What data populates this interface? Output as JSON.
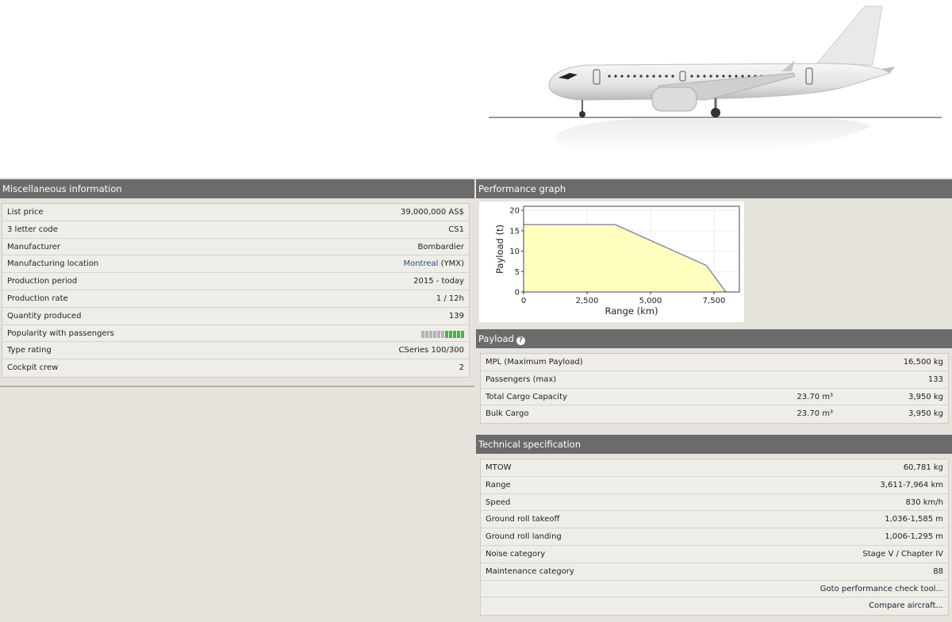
{
  "misc": {
    "title": "Miscellaneous information",
    "rows": [
      {
        "label": "List price",
        "value": "39,000,000 AS$"
      },
      {
        "label": "3 letter code",
        "value": "CS1"
      },
      {
        "label": "Manufacturer",
        "value": "Bombardier"
      },
      {
        "label": "Manufacturing location",
        "value_city": "Montreal",
        "value_code": " (YMX)"
      },
      {
        "label": "Production period",
        "value": "2015 - today"
      },
      {
        "label": "Production rate",
        "value": "1 / 12h"
      },
      {
        "label": "Quantity produced",
        "value": "139"
      },
      {
        "label": "Popularity with passengers",
        "popularity": {
          "filled": 5,
          "total": 11
        }
      },
      {
        "label": "Type rating",
        "value": "CSeries 100/300"
      },
      {
        "label": "Cockpit crew",
        "value": "2"
      }
    ]
  },
  "performance": {
    "title": "Performance graph"
  },
  "chart_data": {
    "type": "area",
    "x": [
      0,
      3611,
      7200,
      7964
    ],
    "y": [
      16.5,
      16.5,
      6.5,
      0
    ],
    "xlabel": "Range (km)",
    "ylabel": "Payload (t)",
    "xlim": [
      0,
      8500
    ],
    "ylim": [
      0,
      21
    ],
    "xticks": [
      "0",
      "2,500",
      "5,000",
      "7,500"
    ],
    "yticks": [
      "0",
      "5",
      "10",
      "15",
      "20"
    ],
    "grid": true,
    "fill_color": "#ffffc0",
    "line_color": "#8888cc"
  },
  "payload": {
    "title": "Payload",
    "rows": [
      {
        "label": "MPL (Maximum Payload)",
        "mid": "",
        "value": "16,500 kg"
      },
      {
        "label": "Passengers (max)",
        "mid": "",
        "value": "133"
      },
      {
        "label": "Total Cargo Capacity",
        "mid": "23.70 m³",
        "value": "3,950 kg"
      },
      {
        "label": "Bulk Cargo",
        "mid": "23.70 m³",
        "value": "3,950 kg"
      }
    ]
  },
  "tech": {
    "title": "Technical specification",
    "rows": [
      {
        "label": "MTOW",
        "value": "60,781 kg"
      },
      {
        "label": "Range",
        "value": "3,611-7,964 km"
      },
      {
        "label": "Speed",
        "value": "830 km/h"
      },
      {
        "label": "Ground roll takeoff",
        "value": "1,036-1,585 m"
      },
      {
        "label": "Ground roll landing",
        "value": "1,006-1,295 m"
      },
      {
        "label": "Noise category",
        "value": "Stage V / Chapter IV"
      },
      {
        "label": "Maintenance category",
        "value": "88"
      }
    ],
    "links": [
      "Goto performance check tool...",
      "Compare aircraft..."
    ]
  },
  "colors": {
    "header": "#6b6b6b",
    "popularity_on": "#4caf50",
    "popularity_off": "#b5b5b5"
  }
}
